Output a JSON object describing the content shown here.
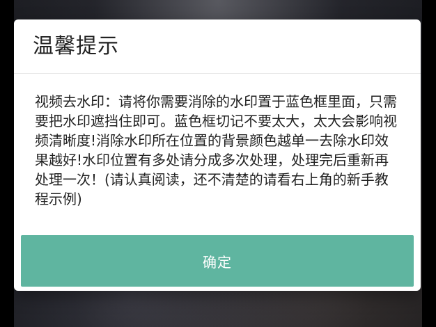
{
  "dialog": {
    "title": "温馨提示",
    "message": "视频去水印：请将你需要消除的水印置于蓝色框里面，只需要把水印遮挡住即可。蓝色框切记不要太大，太大会影响视频清晰度!消除水印所在位置的背景颜色越单一去除水印效果越好!水印位置有多处请分成多次处理，处理完后重新再处理一次！(请认真阅读，还不清楚的请看右上角的新手教程示例)",
    "confirm_label": "确定"
  },
  "colors": {
    "confirm_button": "#5fb5a0",
    "dialog_background": "#ffffff",
    "overlay": "#0b0b0c"
  }
}
